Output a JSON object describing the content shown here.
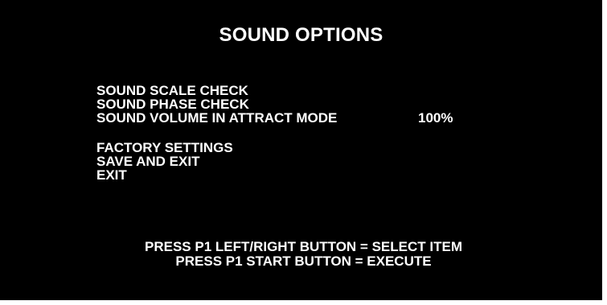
{
  "title": "SOUND OPTIONS",
  "menu": {
    "items": [
      {
        "label": "SOUND SCALE CHECK",
        "value": ""
      },
      {
        "label": "SOUND PHASE CHECK",
        "value": ""
      },
      {
        "label": "SOUND VOLUME IN ATTRACT MODE",
        "value": "100%"
      },
      {
        "label": "FACTORY SETTINGS",
        "value": ""
      },
      {
        "label": "SAVE AND EXIT",
        "value": ""
      },
      {
        "label": "EXIT",
        "value": ""
      }
    ]
  },
  "help": [
    "PRESS P1 LEFT/RIGHT BUTTON = SELECT ITEM",
    "PRESS P1 START BUTTON = EXECUTE"
  ],
  "colors": {
    "background": "#000000",
    "text": "#ffffff",
    "border": "#ffffff"
  }
}
